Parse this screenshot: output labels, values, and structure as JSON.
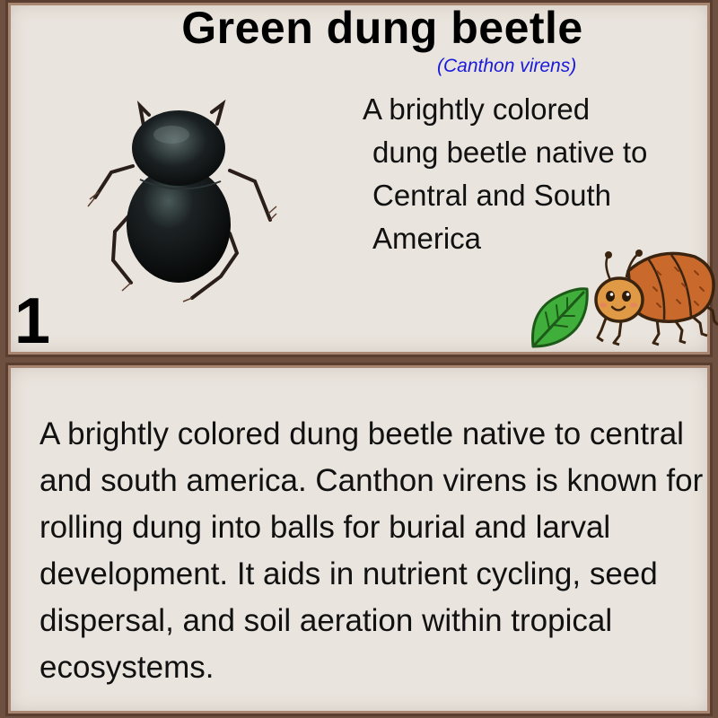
{
  "card": {
    "title": "Green dung beetle",
    "scientific_name": "(Canthon virens)",
    "short_description_lines": [
      "A brightly colored",
      "dung beetle native to",
      "Central and South",
      "America"
    ],
    "number": "1",
    "long_description": "A brightly colored dung beetle native to central and south america. Canthon virens is known for rolling dung into balls for burial and larval development. It aids in nutrient cycling, seed dispersal, and soil aeration within tropical ecosystems.",
    "icons": {
      "photo": "dung-beetle-photo",
      "habitat": "green-leaf-icon",
      "type": "cartoon-beetle-icon"
    },
    "colors": {
      "panel": "#e9e4dd",
      "frame": "#6e5040",
      "scientific_name": "#1a1adc",
      "leaf": "#3fae3a"
    }
  }
}
